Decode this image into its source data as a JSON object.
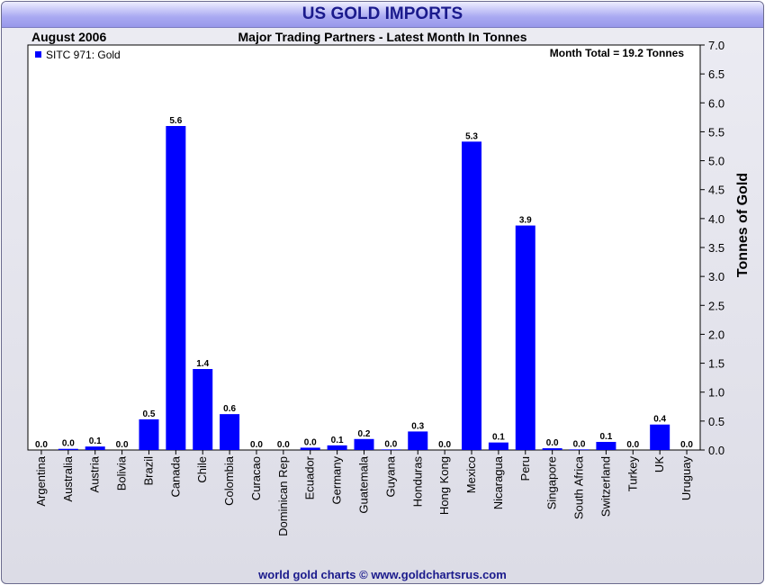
{
  "header": {
    "title": "US GOLD IMPORTS",
    "date_label": "August 2006",
    "subtitle": "Major Trading Partners - Latest Month In Tonnes"
  },
  "footer": {
    "credit": "world gold charts © www.goldchartsrus.com"
  },
  "colors": {
    "bar": "#0000ff",
    "title": "#1a1a8c"
  },
  "chart_data": {
    "type": "bar",
    "title": "US GOLD IMPORTS",
    "subtitle": "Major Trading Partners - Latest Month In Tonnes",
    "ylabel": "Tonnes of Gold",
    "ylim": [
      0,
      7.0
    ],
    "ytick_step": 0.5,
    "yaxis_side": "right",
    "grid": false,
    "legend": {
      "position": "top-left",
      "entries": [
        "SITC 971: Gold"
      ]
    },
    "annotation": "Month Total = 19.2 Tonnes",
    "categories": [
      "Argentina",
      "Australia",
      "Austria",
      "Bolivia",
      "Brazil",
      "Canada",
      "Chile",
      "Colombia",
      "Curacao",
      "Dominican Rep",
      "Ecuador",
      "Germany",
      "Guatemala",
      "Guyana",
      "Honduras",
      "Hong Kong",
      "Mexico",
      "Nicaragua",
      "Peru",
      "Singapore",
      "South Africa",
      "Switzerland",
      "Turkey",
      "UK",
      "Uruguay"
    ],
    "series": [
      {
        "name": "SITC 971: Gold",
        "values": [
          0.0,
          0.02,
          0.06,
          0.0,
          0.53,
          5.6,
          1.4,
          0.62,
          0.0,
          0.0,
          0.04,
          0.08,
          0.19,
          0.01,
          0.32,
          0.0,
          5.33,
          0.13,
          3.88,
          0.03,
          0.01,
          0.14,
          0.0,
          0.44,
          0.0
        ],
        "labels": [
          "0.0",
          "0.0",
          "0.1",
          "0.0",
          "0.5",
          "5.6",
          "1.4",
          "0.6",
          "0.0",
          "0.0",
          "0.0",
          "0.1",
          "0.2",
          "0.0",
          "0.3",
          "0.0",
          "5.3",
          "0.1",
          "3.9",
          "0.0",
          "0.0",
          "0.1",
          "0.0",
          "0.4",
          "0.0"
        ]
      }
    ]
  }
}
